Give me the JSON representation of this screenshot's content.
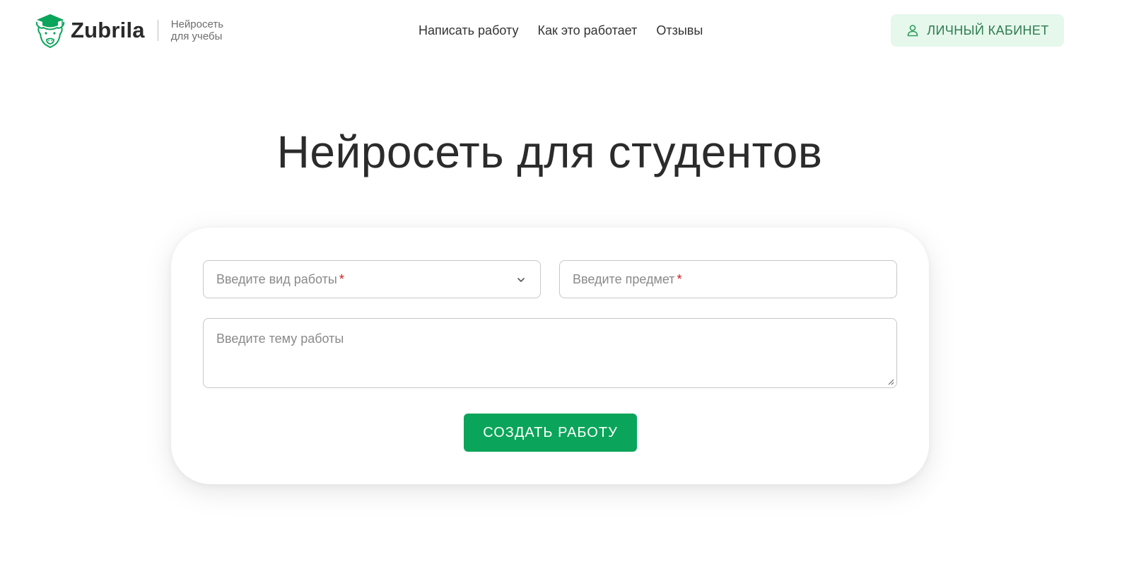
{
  "header": {
    "logo": {
      "text": "Zubrila",
      "tagline_line1": "Нейросеть",
      "tagline_line2": "для учебы",
      "icon": "bison-graduate-icon",
      "color": "#0aa55a"
    },
    "nav": [
      {
        "label": "Написать работу"
      },
      {
        "label": "Как это работает"
      },
      {
        "label": "Отзывы"
      }
    ],
    "cabinet_button": {
      "label": "ЛИЧНЫЙ КАБИНЕТ",
      "icon": "user-icon"
    }
  },
  "hero": {
    "title": "Нейросеть для студентов"
  },
  "form": {
    "work_type": {
      "placeholder": "Введите вид работы",
      "required_mark": "*",
      "icon": "chevron-down-icon"
    },
    "subject": {
      "placeholder": "Введите предмет",
      "required_mark": "*"
    },
    "topic": {
      "placeholder": "Введите тему работы"
    },
    "submit_label": "СОЗДАТЬ РАБОТУ"
  },
  "colors": {
    "accent": "#0aa55a",
    "accent_light": "#e6f7ec",
    "required": "#d11a1a",
    "text": "#2b2b2b"
  }
}
